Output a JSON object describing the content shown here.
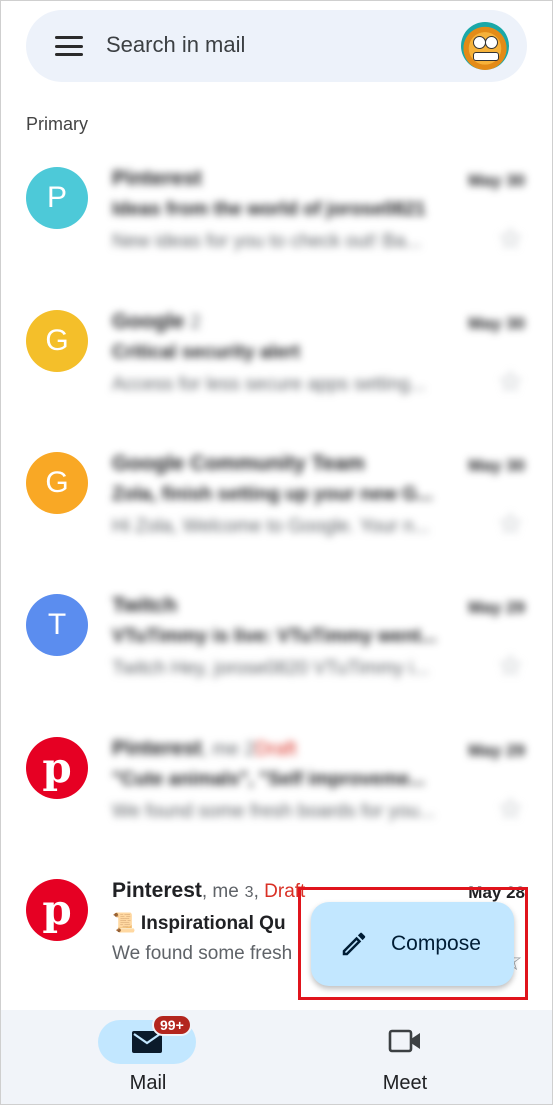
{
  "search": {
    "placeholder": "Search in mail"
  },
  "section_label": "Primary",
  "rows": [
    {
      "avatar_letter": "P",
      "avatar_color": "#4dc9d8",
      "sender": "Pinterest",
      "date": "May 30",
      "subject": "Ideas from the world of jorose0821",
      "preview": "New ideas for you to check out! Ba..."
    },
    {
      "avatar_letter": "G",
      "avatar_color": "#f4bf2a",
      "sender": "Google",
      "count": "2",
      "date": "May 30",
      "subject": "Critical security alert",
      "preview": "Access for less secure apps setting..."
    },
    {
      "avatar_letter": "G",
      "avatar_color": "#f9a825",
      "sender": "Google Community Team",
      "date": "May 30",
      "subject": "Zola, finish setting up your new G...",
      "preview": "Hi Zola, Welcome to Google. Your n..."
    },
    {
      "avatar_letter": "T",
      "avatar_color": "#5b8def",
      "sender": "Twitch",
      "date": "May 29",
      "subject": "VTuTimmy is live: VTuTimmy went...",
      "preview": "Twitch Hey, jorose0820 VTuTimmy i..."
    },
    {
      "sender": "Pinterest",
      "me": ", me",
      "count": "2",
      "draft": "Draft",
      "date": "May 29",
      "subject": "\"Cute animals\", \"Self improveme...",
      "preview": "We found some fresh boards for you..."
    },
    {
      "sender": "Pinterest",
      "me": ", me",
      "count": "3",
      "draft": "Draft",
      "date": "May 28",
      "subject": "📜 Inspirational Qu",
      "preview": "We found some fresh"
    }
  ],
  "compose": {
    "label": "Compose"
  },
  "nav": {
    "mail": {
      "label": "Mail",
      "badge": "99+"
    },
    "meet": {
      "label": "Meet"
    }
  }
}
